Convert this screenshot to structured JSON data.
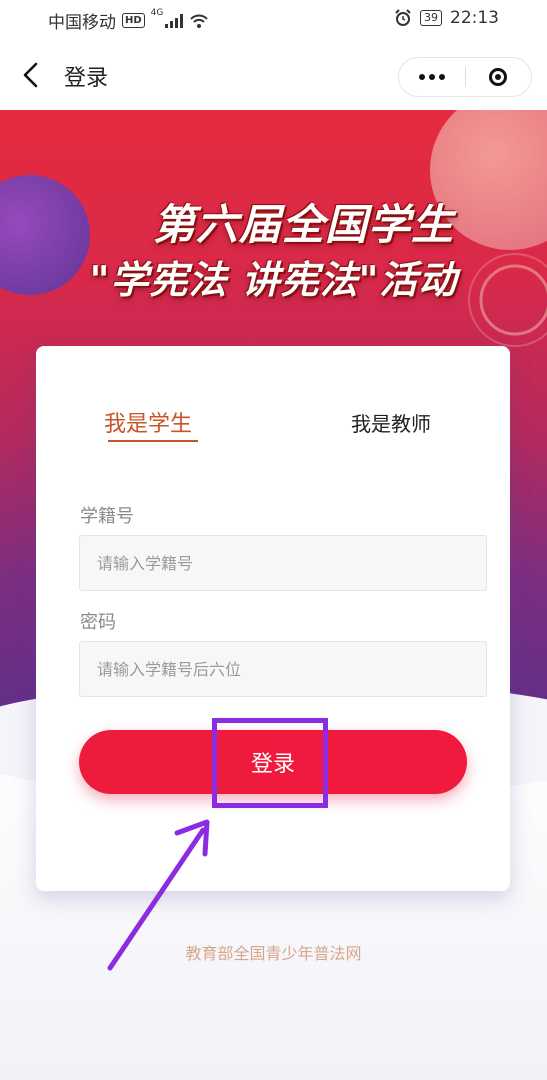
{
  "status_bar": {
    "carrier": "中国移动",
    "hd": "HD",
    "network": "4G",
    "battery": "39",
    "time": "22:13"
  },
  "nav": {
    "title": "登录"
  },
  "banner": {
    "line1": "第六届全国学生",
    "line2": "\"学宪法 讲宪法\"活动"
  },
  "tabs": {
    "student": "我是学生",
    "teacher": "我是教师"
  },
  "form": {
    "student_id_label": "学籍号",
    "student_id_placeholder": "请输入学籍号",
    "password_label": "密码",
    "password_placeholder": "请输入学籍号后六位",
    "login_button": "登录"
  },
  "footer": {
    "text": "教育部全国青少年普法网"
  },
  "colors": {
    "accent_red": "#ee1c3c",
    "tab_active": "#c8542a",
    "annotation_purple": "#8b2be2"
  }
}
